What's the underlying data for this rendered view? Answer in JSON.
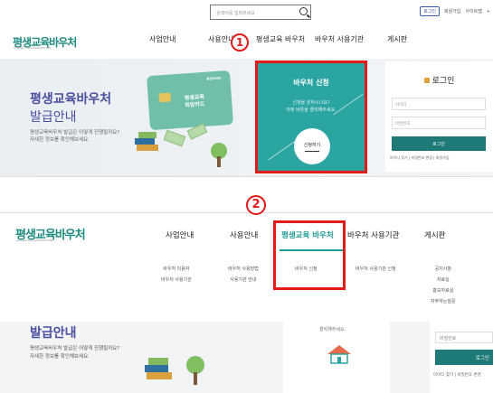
{
  "search": {
    "placeholder": "검색어를 입력하세요"
  },
  "util_links": {
    "login": "로그인",
    "signup": "회원가입",
    "sitemap": "사이트맵",
    "plus": "+"
  },
  "logo": {
    "text": "평생교육바우처",
    "subtext": "LIFELONG EDUCATION VOUCHER"
  },
  "nav_top": [
    "사업안내",
    "사용안내",
    "평생교육 바우처",
    "바우처 사용기관",
    "게시판"
  ],
  "hero": {
    "title_line1": "평생교육바우처",
    "title_line2": "발급안내",
    "desc_line1": "평생교육바우처 발급은 어떻게 진행될까요?",
    "desc_line2": "자세한 정보를 확인해보세요.",
    "card_brand": "평생교육바",
    "card_text_line1": "평생교육",
    "card_text_line2": "희망카드"
  },
  "voucher_box": {
    "title": "바우처 신청",
    "desc_line1": "신청을 원하시나요?",
    "desc_line2": "아래 버튼을 클릭해주세요.",
    "button": "신청하기"
  },
  "login_box": {
    "title": "로그인",
    "id_placeholder": "아이디",
    "pw_placeholder": "비밀번호",
    "button": "로그인",
    "links": "아이디 찾기 | 비밀번호 변경 | 회원가입"
  },
  "markers": {
    "one": "1",
    "two": "2"
  },
  "nav_bottom": [
    "사업안내",
    "사용안내",
    "평생교육 바우처",
    "바우처 사용기관",
    "게시판"
  ],
  "submenus": {
    "col1": [
      "바우처 이용자",
      "바우처 사용기관"
    ],
    "col2": [
      "바우처 사용방법",
      "사용기관 안내"
    ],
    "col3": [
      "바우처 신청"
    ],
    "col4": [
      "바우처 사용기관 신청"
    ],
    "col5": [
      "공지사항",
      "자료실",
      "홍보자료실",
      "자주하는질문"
    ]
  },
  "hero2": {
    "title": "발급안내",
    "desc_line1": "평생교육바우처 발급은 어떻게 진행될까요?",
    "desc_line2": "자세한 정보를 확인해보세요.",
    "mid_text": "클릭해주세요.",
    "pw_placeholder": "비밀번호",
    "login_button": "로그인",
    "links": "아이디 찾기 | 비밀번호 변경"
  },
  "colors": {
    "brand_teal": "#1d9a93",
    "hero_title": "#4a4e9e",
    "highlight_red": "#e11a1a"
  }
}
